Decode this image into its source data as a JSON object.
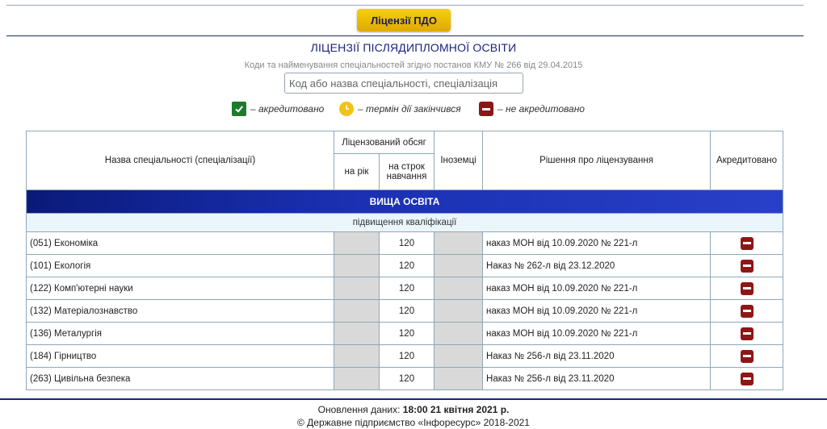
{
  "header": {
    "button_label": "Ліцензії ПДО"
  },
  "page": {
    "title": "ЛІЦЕНЗІЇ ПІСЛЯДИПЛОМНОЇ ОСВІТИ",
    "subtitle": "Коди та найменування спеціальностей згідно постанов КМУ № 266 від 29.04.2015"
  },
  "search": {
    "placeholder": "Код або назва спеціальності, спеціалізація"
  },
  "legend": {
    "accredited": "– акредитовано",
    "expiring": "– термін дії закінчився",
    "not_accredited": "– не акредитовано",
    "colors": {
      "accredited": "#1e7b2e",
      "expiring": "#f2c316",
      "not_accredited": "#8f1616"
    }
  },
  "table": {
    "headers": {
      "name": "Назва спеціальності (спеціалізації)",
      "volume": "Ліцензований обсяг",
      "per_year": "на рік",
      "per_term": "на строк навчання",
      "foreigners": "Іноземці",
      "decision": "Рішення про ліцензування",
      "accredited": "Акредитовано"
    },
    "section": "ВИЩА ОСВІТА",
    "subsection": "підвищення кваліфікації",
    "rows": [
      {
        "name": "(051) Економіка",
        "per_year": "",
        "per_term": "120",
        "foreigners": "",
        "decision": "наказ МОН від 10.09.2020 № 221-л",
        "accredited": "not-accredited-icon"
      },
      {
        "name": "(101) Екологія",
        "per_year": "",
        "per_term": "120",
        "foreigners": "",
        "decision": "Наказ № 262-л від 23.12.2020",
        "accredited": "not-accredited-icon"
      },
      {
        "name": "(122) Комп'ютерні науки",
        "per_year": "",
        "per_term": "120",
        "foreigners": "",
        "decision": "наказ МОН від 10.09.2020 № 221-л",
        "accredited": "not-accredited-icon"
      },
      {
        "name": "(132) Матеріалознавство",
        "per_year": "",
        "per_term": "120",
        "foreigners": "",
        "decision": "наказ МОН від 10.09.2020 № 221-л",
        "accredited": "not-accredited-icon"
      },
      {
        "name": "(136) Металургія",
        "per_year": "",
        "per_term": "120",
        "foreigners": "",
        "decision": "наказ МОН від 10.09.2020 № 221-л",
        "accredited": "not-accredited-icon"
      },
      {
        "name": "(184) Гірництво",
        "per_year": "",
        "per_term": "120",
        "foreigners": "",
        "decision": "Наказ № 256-л від 23.11.2020",
        "accredited": "not-accredited-icon"
      },
      {
        "name": "(263) Цивільна безпека",
        "per_year": "",
        "per_term": "120",
        "foreigners": "",
        "decision": "Наказ № 256-л від 23.11.2020",
        "accredited": "not-accredited-icon"
      }
    ]
  },
  "footer": {
    "updated_label": "Оновлення даних: ",
    "updated_value": "18:00 21 квітня 2021 р.",
    "copyright": "© Державне підприємство «Інфоресурс» 2018-2021"
  }
}
